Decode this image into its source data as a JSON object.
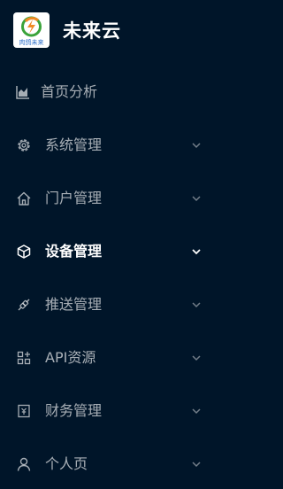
{
  "brand": {
    "app_name": "未来云",
    "logo_text": "肉鸽未来",
    "logo_colors": {
      "green": "#3aa33a",
      "orange": "#f08a24",
      "blue": "#2b6ec9"
    }
  },
  "colors": {
    "sidebar_bg": "#001529",
    "text": "rgba(255,255,255,0.65)",
    "active_text": "#ffffff"
  },
  "menu": [
    {
      "label": "首页分析",
      "icon": "area-chart-icon",
      "has_submenu": false,
      "active": false
    },
    {
      "label": "系统管理",
      "icon": "gear-icon",
      "has_submenu": true,
      "active": false
    },
    {
      "label": "门户管理",
      "icon": "home-icon",
      "has_submenu": true,
      "active": false
    },
    {
      "label": "设备管理",
      "icon": "cube-icon",
      "has_submenu": true,
      "active": true
    },
    {
      "label": "推送管理",
      "icon": "api-plug-icon",
      "has_submenu": true,
      "active": false
    },
    {
      "label": "API资源",
      "icon": "apps-grid-icon",
      "has_submenu": true,
      "active": false
    },
    {
      "label": "财务管理",
      "icon": "money-ticket-icon",
      "has_submenu": true,
      "active": false
    },
    {
      "label": "个人页",
      "icon": "user-icon",
      "has_submenu": true,
      "active": false
    }
  ]
}
